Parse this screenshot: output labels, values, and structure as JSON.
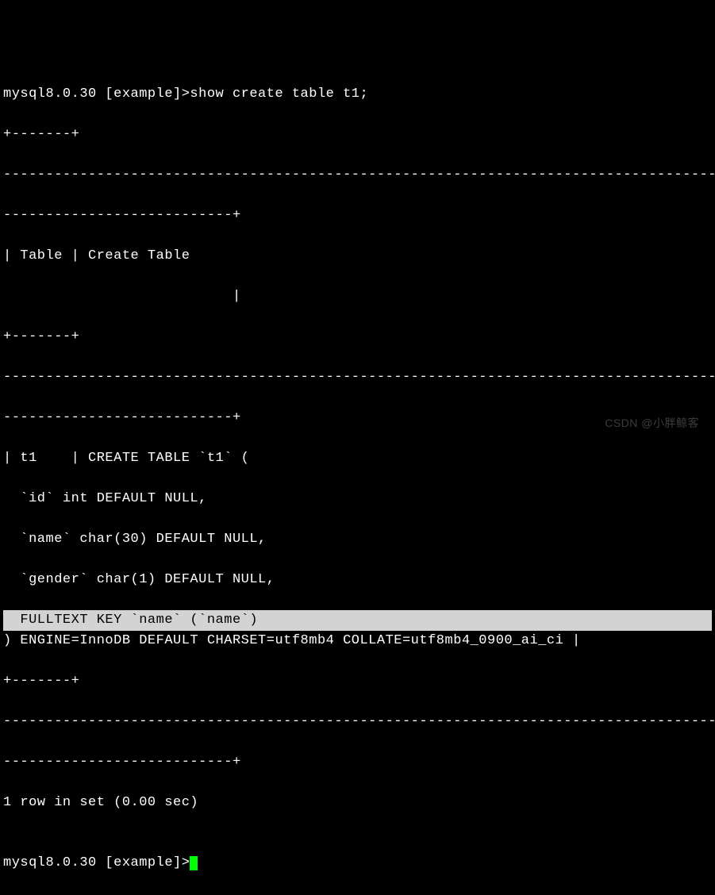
{
  "prompt1": "mysql8.0.30 [example]>show create table t1;",
  "border_top1": "+-------+",
  "border_dash_full": "-----------------------------------------------------------------------------------------",
  "border_dash_end": "---------------------------+",
  "header_row": "| Table | Create Table",
  "header_spacer": "                           |",
  "border_mid1": "+-------+",
  "body_line1": "| t1    | CREATE TABLE `t1` (",
  "body_line2": "  `id` int DEFAULT NULL,",
  "body_line3": "  `name` char(30) DEFAULT NULL,",
  "body_line4": "  `gender` char(1) DEFAULT NULL,",
  "body_line5_hl": "  FULLTEXT KEY `name` (`name`)",
  "body_line6": ") ENGINE=InnoDB DEFAULT CHARSET=utf8mb4 COLLATE=utf8mb4_0900_ai_ci |",
  "border_bot1": "+-------+",
  "result": "1 row in set (0.00 sec)",
  "blank": "",
  "prompt2": "mysql8.0.30 [example]>",
  "watermark": "CSDN @小胖鲸客"
}
